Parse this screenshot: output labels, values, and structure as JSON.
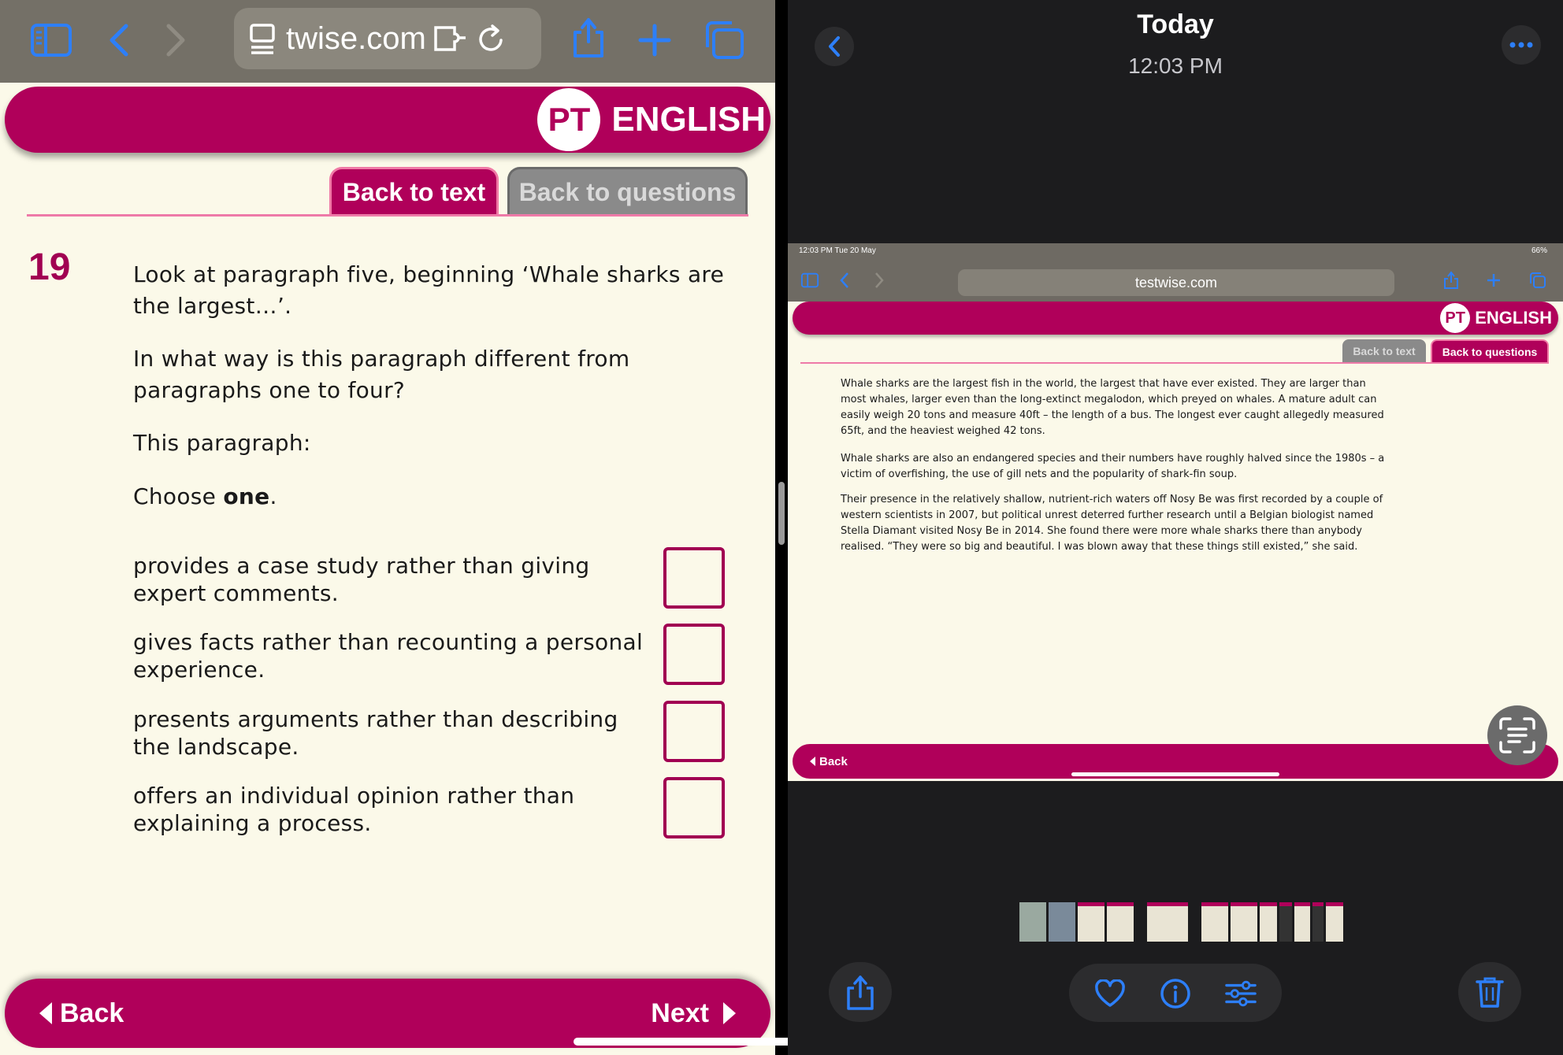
{
  "left": {
    "url": "twise.com",
    "logo": {
      "mark": "PT",
      "text": "ENGLISH"
    },
    "tabs": {
      "back_to_text": "Back to text",
      "back_to_questions": "Back to questions"
    },
    "question": {
      "number": "19",
      "line1": "Look at paragraph five, beginning ‘Whale sharks are the largest…’.",
      "line2": "In what way is this paragraph different from paragraphs one to four?",
      "prompt": "This paragraph:",
      "choose_prefix": "Choose ",
      "choose_bold": "one",
      "choose_suffix": ".",
      "options": [
        "provides a case study rather than giving expert comments.",
        "gives facts rather than recounting a personal experience.",
        "presents arguments rather than describing the landscape.",
        "offers an individual opinion rather than explaining a process."
      ]
    },
    "nav": {
      "back": "Back",
      "next": "Next"
    },
    "icons": [
      "sidebar-icon",
      "chevron-left-icon",
      "chevron-right-icon",
      "reader-icon",
      "extension-icon",
      "reload-icon",
      "share-icon",
      "plus-icon",
      "tabs-icon"
    ],
    "accent_color": "#b0005a"
  },
  "right": {
    "title": "Today",
    "time": "12:03 PM",
    "screenshot": {
      "status_left": "12:03 PM  Tue 20 May",
      "status_right": "66%",
      "url": "testwise.com",
      "logo": {
        "mark": "PT",
        "text": "ENGLISH"
      },
      "tabs": {
        "back_to_text": "Back to text",
        "back_to_questions": "Back to questions"
      },
      "paragraphs": [
        "Whale sharks are the largest fish in the world, the largest that have ever existed. They are larger than most whales, larger even than the long-extinct megalodon, which preyed on whales. A mature adult can easily weigh 20 tons and measure 40ft – the length of a bus. The longest ever caught allegedly measured 65ft, and the heaviest weighed 42 tons.",
        "Whale sharks are also an endangered species and their numbers have roughly halved since the 1980s – a victim of overfishing, the use of gill nets and the popularity of shark-fin soup.",
        "Their presence in the relatively shallow, nutrient-rich waters off Nosy Be was first recorded by a couple of western scientists in 2007, but political unrest deterred further research until a Belgian biologist named Stella Diamant visited Nosy Be in 2014. She found there were more whale sharks there than anybody realised. “They were so big and beautiful. I was blown away that these things still existed,” she said."
      ],
      "back": "Back"
    },
    "icons": [
      "back-icon",
      "more-icon",
      "live-text-icon",
      "share-icon",
      "heart-icon",
      "info-icon",
      "adjust-icon",
      "trash-icon"
    ]
  }
}
